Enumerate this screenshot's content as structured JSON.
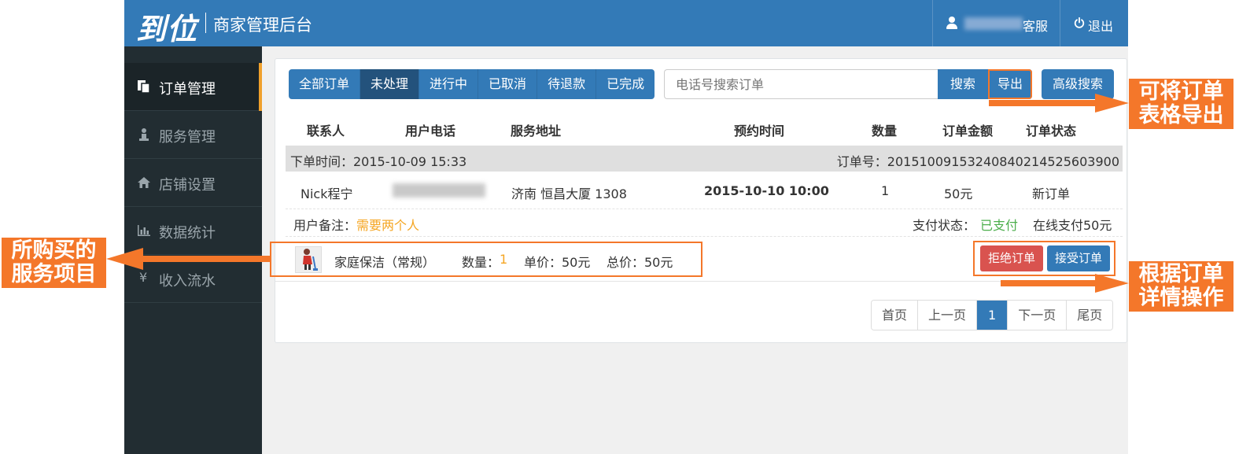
{
  "header": {
    "logo": "到位",
    "title": "商家管理后台",
    "user_suffix": "客服",
    "logout": "退出"
  },
  "sidebar": {
    "items": [
      {
        "label": "订单管理",
        "icon": "copy-icon",
        "active": true
      },
      {
        "label": "服务管理",
        "icon": "person-icon"
      },
      {
        "label": "店铺设置",
        "icon": "home-icon"
      },
      {
        "label": "数据统计",
        "icon": "bar-chart-icon"
      },
      {
        "label": "收入流水",
        "icon": "yen-icon"
      }
    ]
  },
  "tabs": [
    {
      "label": "全部订单"
    },
    {
      "label": "未处理",
      "active": true
    },
    {
      "label": "进行中"
    },
    {
      "label": "已取消"
    },
    {
      "label": "待退款"
    },
    {
      "label": "已完成"
    }
  ],
  "search": {
    "placeholder": "电话号搜索订单",
    "search_label": "搜索",
    "export_label": "导出",
    "advanced_label": "高级搜索"
  },
  "table": {
    "columns": [
      "联系人",
      "用户电话",
      "服务地址",
      "预约时间",
      "数量",
      "订单金额",
      "订单状态"
    ]
  },
  "order": {
    "created_time": "下单时间：2015-10-09 15:33",
    "order_no": "订单号：20151009153240840214525603900",
    "contact": "Nick程宁",
    "address": "济南 恒昌大厦 1308",
    "appointment": "2015-10-10 10:00",
    "quantity": "1",
    "amount": "50元",
    "status": "新订单",
    "remark_label": "用户备注：",
    "remark_value": "需要两个人",
    "pay_status_label": "支付状态：",
    "pay_status_value": "已支付",
    "pay_method": "在线支付50元",
    "item_name": "家庭保洁（常规）",
    "item_qty_label": "数量：",
    "item_qty_value": "1",
    "item_unit_price": "单价：50元",
    "item_total": "总价：50元",
    "reject_label": "拒绝订单",
    "accept_label": "接受订单"
  },
  "pagination": [
    "首页",
    "上一页",
    "1",
    "下一页",
    "尾页"
  ],
  "annotations": {
    "export_line1": "可将订单",
    "export_line2": "表格导出",
    "item_line1": "所购买的",
    "item_line2": "服务项目",
    "action_line1": "根据订单",
    "action_line2": "详情操作"
  },
  "colors": {
    "primary": "#337ab7",
    "danger": "#d9534f",
    "annotation": "#f4772a",
    "sidebar": "#222d32",
    "highlight": "#f5a623",
    "success": "#4cae4c"
  }
}
